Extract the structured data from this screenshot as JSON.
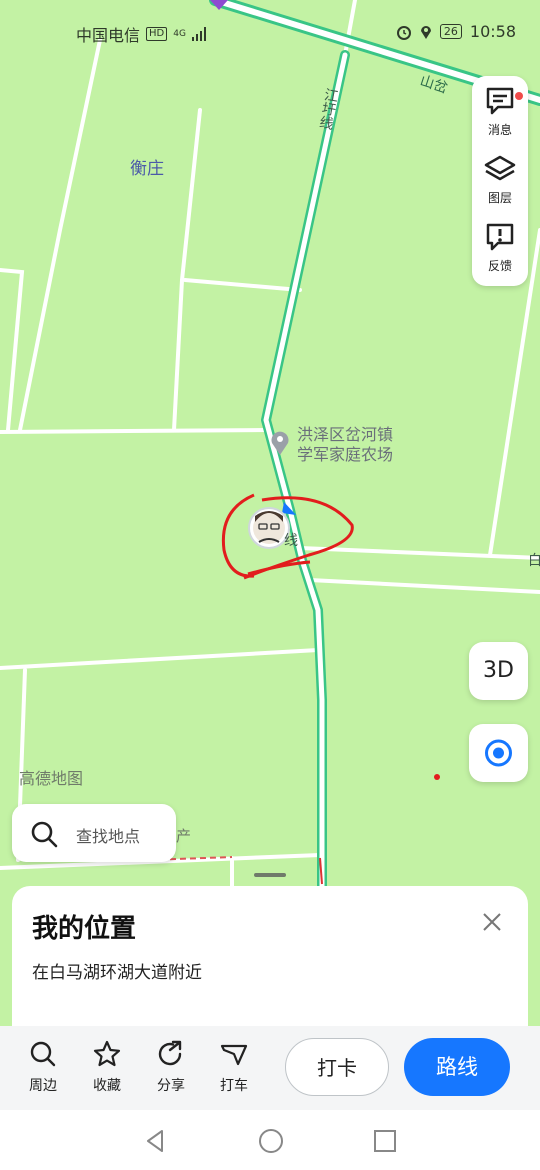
{
  "status_bar": {
    "carrier": "中国电信",
    "hd": "HD",
    "network": "4G",
    "battery": "26",
    "time": "10:58"
  },
  "map": {
    "place_labels": [
      "衡庄"
    ],
    "road_labels": [
      "山岔",
      "江圩线"
    ],
    "poi": {
      "line1": "洪泽区岔河镇",
      "line2": "学军家庭农场"
    },
    "marker_char": "线",
    "watermark": "高德地图",
    "partial_text": "产",
    "right_edge_label": "白"
  },
  "side_panel": {
    "items": [
      {
        "label": "消息",
        "icon": "message-icon"
      },
      {
        "label": "图层",
        "icon": "layers-icon"
      },
      {
        "label": "反馈",
        "icon": "feedback-icon"
      }
    ]
  },
  "controls": {
    "three_d_label": "3D"
  },
  "search": {
    "placeholder": "查找地点"
  },
  "location_card": {
    "title": "我的位置",
    "subtitle": "在白马湖环湖大道附近"
  },
  "toolbar": {
    "items": [
      {
        "label": "周边",
        "icon": "search-icon"
      },
      {
        "label": "收藏",
        "icon": "star-icon"
      },
      {
        "label": "分享",
        "icon": "share-icon"
      },
      {
        "label": "打车",
        "icon": "taxi-icon"
      }
    ],
    "checkin_label": "打卡",
    "route_label": "路线"
  },
  "colors": {
    "map_background": "#c3f2a4",
    "road": "#ffffff",
    "highway_edge": "#39c586",
    "accent_blue": "#1677ff",
    "annotation_red": "#e21d1d"
  }
}
